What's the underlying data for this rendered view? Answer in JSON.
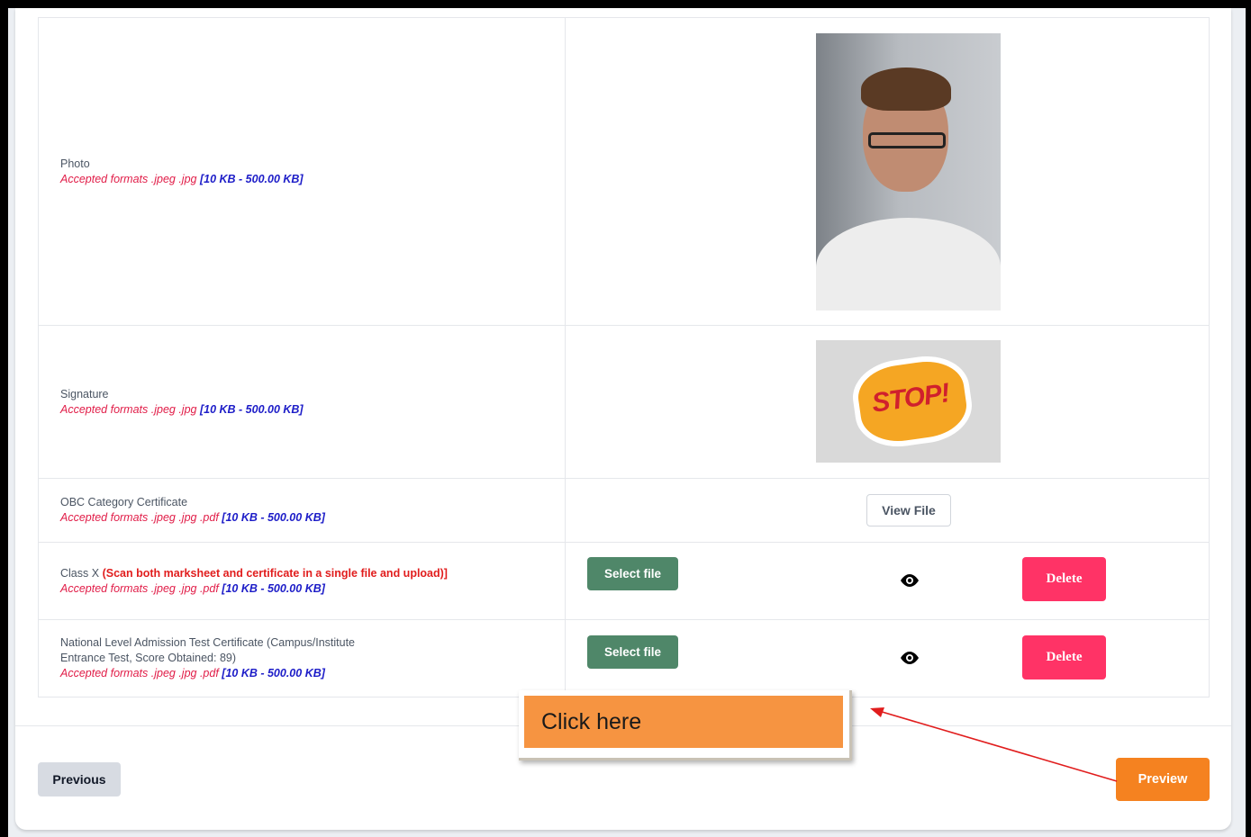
{
  "rows": [
    {
      "title": "Photo",
      "formats": "Accepted formats .jpeg .jpg",
      "size": "[10 KB - 500.00 KB]"
    },
    {
      "title": "Signature",
      "formats": "Accepted formats .jpeg .jpg",
      "size": "[10 KB - 500.00 KB]",
      "image_text": "STOP!"
    },
    {
      "title": "OBC Category Certificate",
      "formats": "Accepted formats .jpeg .jpg .pdf",
      "size": "[10 KB - 500.00 KB]",
      "view_label": "View File"
    },
    {
      "title": "Class X",
      "note": "(Scan both marksheet and certificate in a single file and upload)]",
      "formats": "Accepted formats .jpeg .jpg .pdf",
      "size": "[10 KB - 500.00 KB]",
      "select_label": "Select file",
      "delete_label": "Delete"
    },
    {
      "title_line1": "National Level Admission Test Certificate (Campus/Institute",
      "title_line2": "Entrance Test, Score Obtained: 89)",
      "formats": "Accepted formats .jpeg .jpg .pdf",
      "size": "[10 KB - 500.00 KB]",
      "select_label": "Select file",
      "delete_label": "Delete"
    }
  ],
  "footer": {
    "previous_label": "Previous",
    "preview_label": "Preview"
  },
  "callout": {
    "text": "Click here"
  },
  "icons": {
    "view": "eye-icon"
  },
  "colors": {
    "select": "#4f8769",
    "delete": "#ff3366",
    "preview": "#f58220",
    "callout": "#f69441",
    "arrow": "#e11d1d"
  }
}
